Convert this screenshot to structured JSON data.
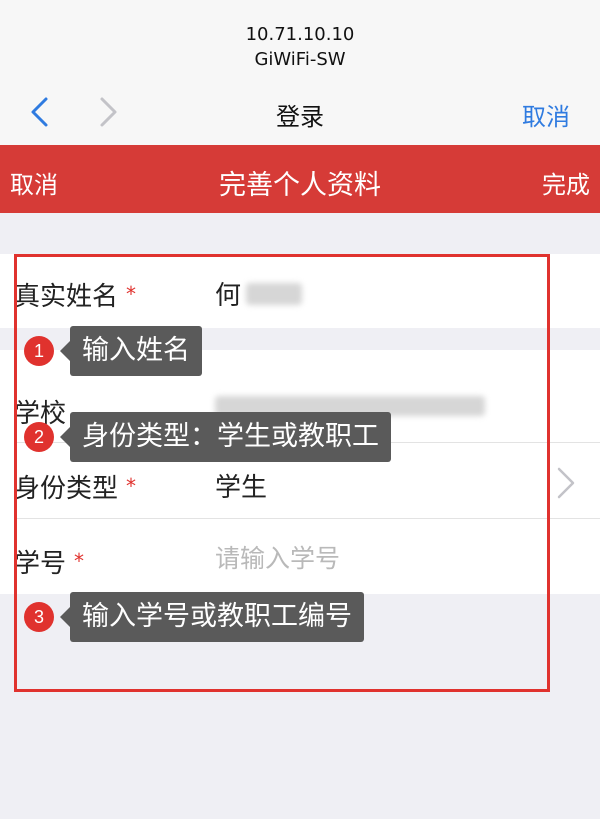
{
  "status": {
    "ip": "10.71.10.10",
    "ssid": "GiWiFi-SW"
  },
  "nav": {
    "title": "登录",
    "cancel": "取消"
  },
  "redbar": {
    "cancel": "取消",
    "title": "完善个人资料",
    "done": "完成"
  },
  "form": {
    "name_label": "真实姓名",
    "name_value": "何",
    "school_label": "学校",
    "identity_label": "身份类型",
    "identity_value": "学生",
    "id_label": "学号",
    "id_placeholder": "请输入学号",
    "required_mark": "*"
  },
  "tips": [
    {
      "num": "1",
      "text": "输入姓名"
    },
    {
      "num": "2",
      "text": "身份类型：学生或教职工"
    },
    {
      "num": "3",
      "text": "输入学号或教职工编号"
    }
  ],
  "colors": {
    "accent": "#d63b37",
    "link": "#2f7be0",
    "highlight": "#e0322e",
    "tip_bg": "#5a5a5a"
  }
}
